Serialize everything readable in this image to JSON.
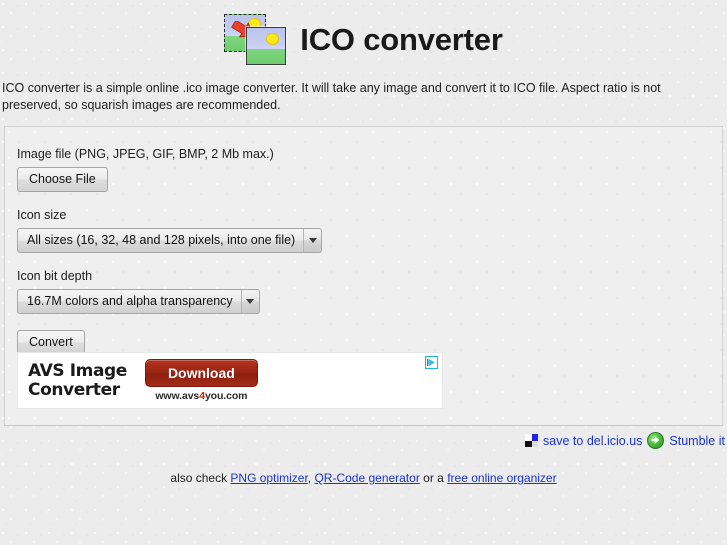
{
  "header": {
    "title": "ICO converter",
    "logo_icon": "image-convert-icon"
  },
  "intro": {
    "text": "ICO converter is a simple online .ico image converter. It will take any image and convert it to ICO file. Aspect ratio is not preserved, so squarish images are recommended."
  },
  "form": {
    "file": {
      "label": "Image file (PNG, JPEG, GIF, BMP, 2 Mb max.)",
      "button_label": "Choose File",
      "value": ""
    },
    "icon_size": {
      "label": "Icon size",
      "selected": "All sizes (16, 32, 48 and 128 pixels, into one file)"
    },
    "bit_depth": {
      "label": "Icon bit depth",
      "selected": "16.7M colors and alpha transparency"
    },
    "submit_label": "Convert"
  },
  "ad": {
    "brand_line1": "AVS Image",
    "brand_line2": "Converter",
    "button_label": "Download",
    "url_pre": "www.avs",
    "url_hl": "4",
    "url_post": "you.com",
    "adchoices_icon": "adchoices-icon"
  },
  "social": {
    "delicious_icon": "delicious-icon",
    "delicious_label": "save to del.icio.us",
    "stumble_icon": "stumbleupon-icon",
    "stumble_label": "Stumble it"
  },
  "footer": {
    "prefix": "also check ",
    "link1": "PNG optimizer",
    "sep1": ", ",
    "link2": "QR-Code generator",
    "sep2": " or a ",
    "link3": "free online organizer"
  },
  "colors": {
    "link": "#1a34d8",
    "ad_red": "#9c2514",
    "accent_yellow": "#ffe81a",
    "accent_green": "#6fcb6e"
  }
}
